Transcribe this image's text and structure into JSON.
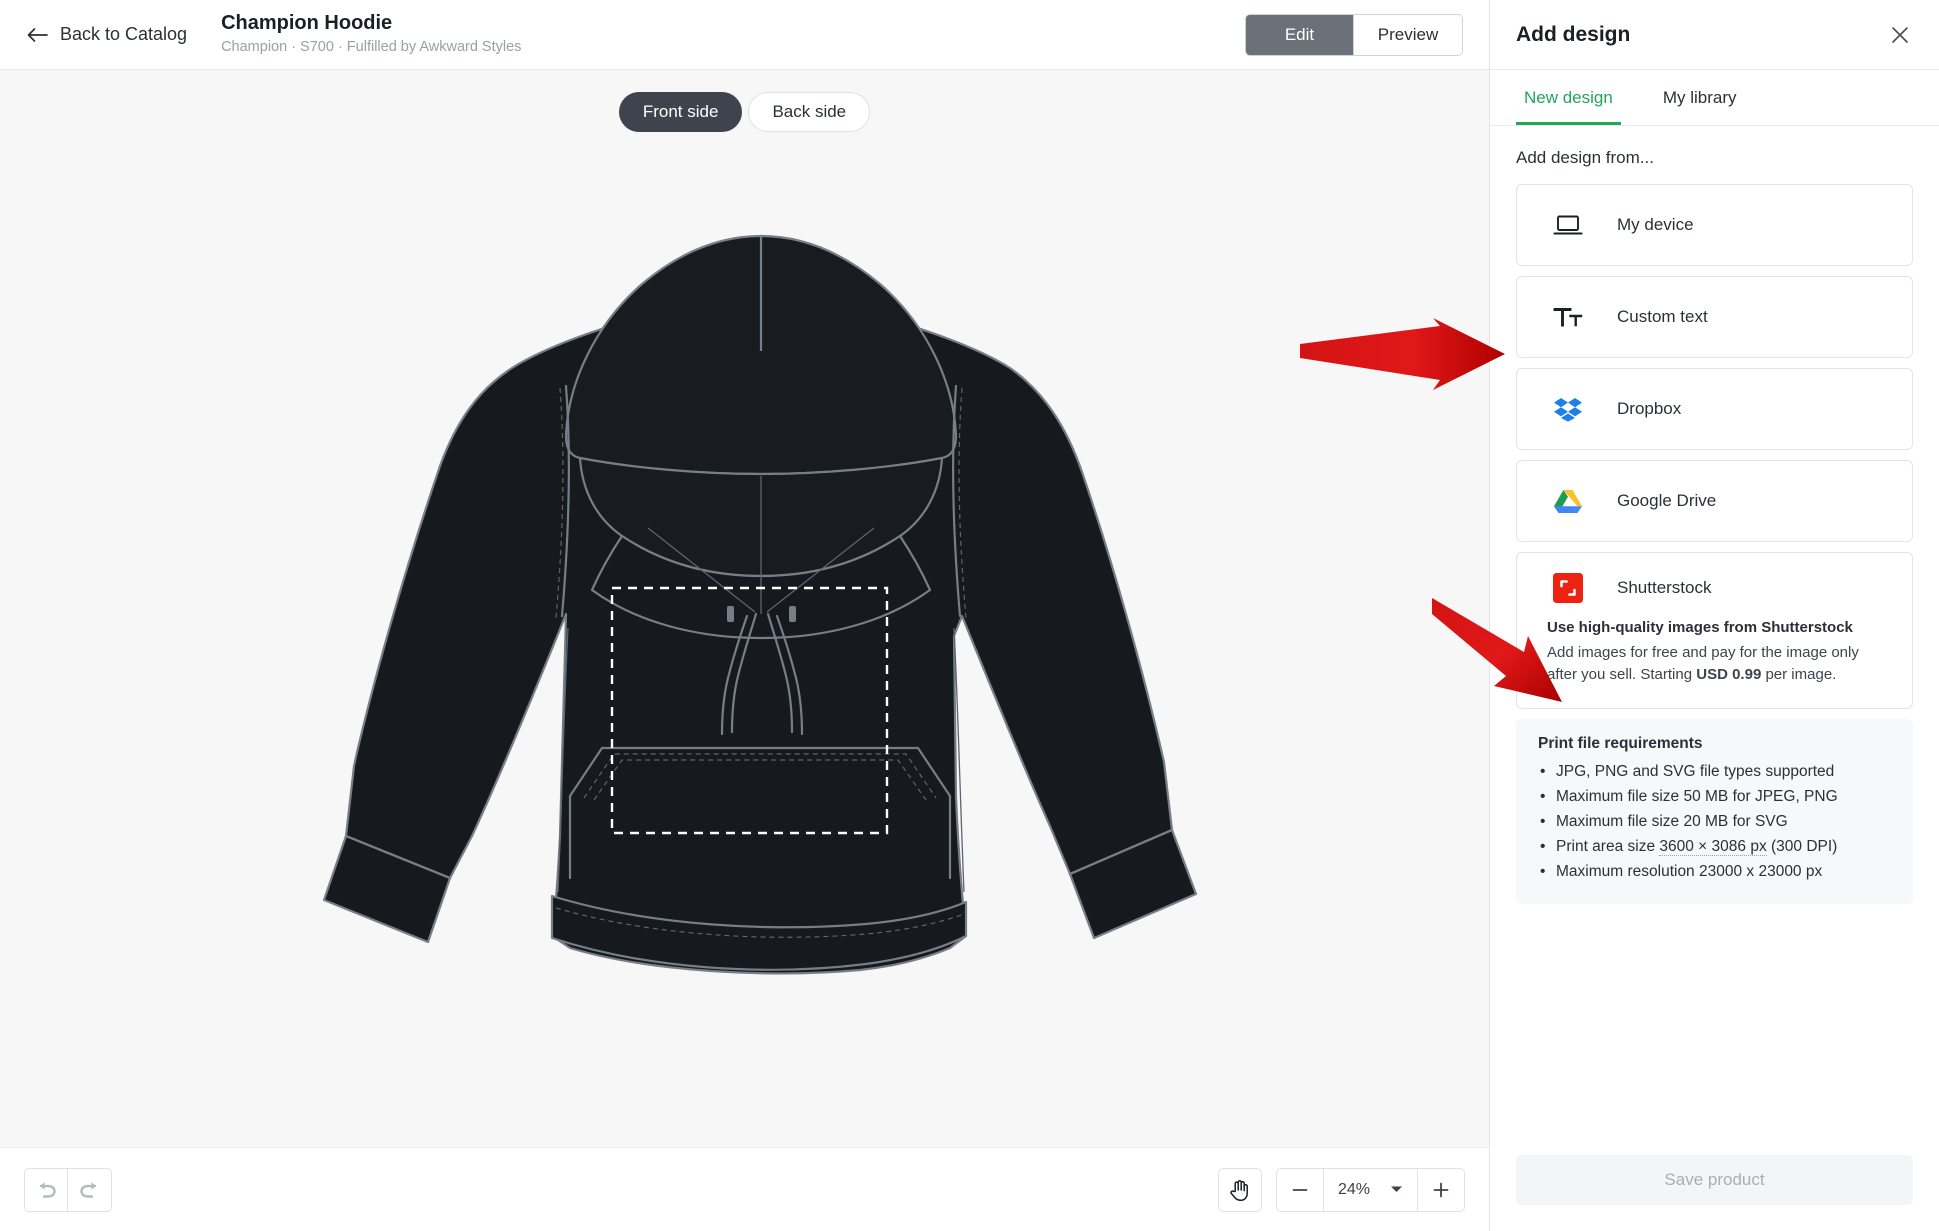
{
  "topbar": {
    "back_label": "Back to Catalog",
    "back_icon": "arrow-left-icon",
    "product_title": "Champion Hoodie",
    "product_subtitle": "Champion · S700 · Fulfilled by Awkward Styles",
    "view_modes": [
      {
        "label": "Edit",
        "active": true
      },
      {
        "label": "Preview",
        "active": false
      }
    ]
  },
  "canvas": {
    "sides": [
      {
        "label": "Front side",
        "active": true
      },
      {
        "label": "Back side",
        "active": false
      }
    ],
    "garment": {
      "name": "champion-hoodie-front-mockup",
      "fabric_color": "#16191d",
      "stitch_color": "#767e88",
      "background_color": "#f7f7f7",
      "print_area_border": "#ffffff"
    }
  },
  "bottombar": {
    "undo_icon": "undo-icon",
    "redo_icon": "redo-icon",
    "pan_icon": "hand-pan-icon",
    "zoom_out_icon": "minus-icon",
    "zoom_in_icon": "plus-icon",
    "zoom_caret_icon": "chevron-down-icon",
    "zoom_level": "24%"
  },
  "panel": {
    "title": "Add design",
    "close_icon": "close-icon",
    "tabs": [
      {
        "label": "New design",
        "active": true
      },
      {
        "label": "My library",
        "active": false
      }
    ],
    "section_label": "Add design from...",
    "sources": [
      {
        "label": "My device",
        "icon": "laptop-icon"
      },
      {
        "label": "Custom text",
        "icon": "text-format-icon"
      },
      {
        "label": "Dropbox",
        "icon": "dropbox-icon"
      },
      {
        "label": "Google Drive",
        "icon": "google-drive-icon"
      }
    ],
    "shutterstock": {
      "label": "Shutterstock",
      "icon": "shutterstock-icon",
      "headline": "Use high-quality images from Shutterstock",
      "desc_part1": "Add images for free and pay for the image only after you sell. Starting ",
      "desc_price": "USD 0.99",
      "desc_part2": " per image."
    },
    "requirements": {
      "title": "Print file requirements",
      "items": [
        "JPG, PNG and SVG file types supported",
        "Maximum file size 50 MB for JPEG, PNG",
        "Maximum file size 20 MB for SVG",
        "Print area size 3600 × 3086 px (300 DPI)",
        "Maximum resolution 23000 x 23000 px"
      ],
      "print_area_prefix": "Print area size ",
      "print_area_value": "3600 × 3086 px",
      "print_area_suffix": " (300 DPI)"
    },
    "save_label": "Save product"
  },
  "annotations": {
    "arrow_color": "#cc0000",
    "arrows": [
      {
        "name": "arrow-pointing-to-dropbox",
        "direction": "right"
      },
      {
        "name": "arrow-pointing-to-print-requirements",
        "direction": "down-right"
      }
    ]
  },
  "colors": {
    "accent_green": "#21a65a",
    "dark_chrome": "#3d444d",
    "seg_active": "#6b7179"
  }
}
